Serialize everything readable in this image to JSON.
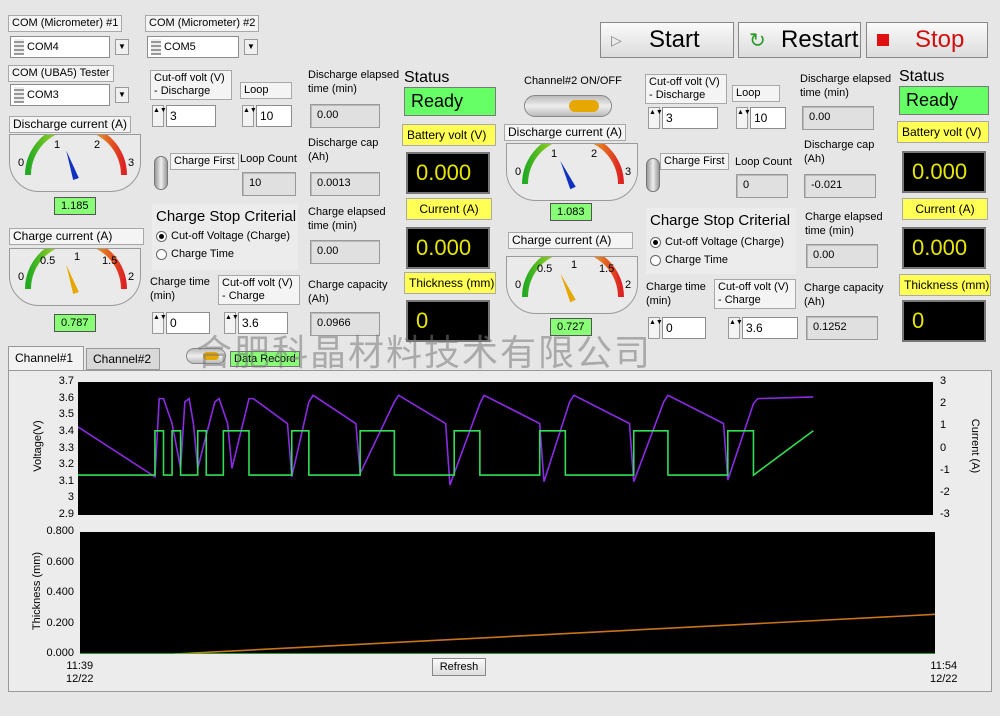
{
  "top": {
    "start": "Start",
    "restart": "Restart",
    "stop": "Stop"
  },
  "com": {
    "mic1_label": "COM (Micrometer) #1",
    "mic1_value": "COM4",
    "mic2_label": "COM (Micrometer) #2",
    "mic2_value": "COM5",
    "uba_label": "COM (UBA5) Tester",
    "uba_value": "COM3"
  },
  "ch1": {
    "discharge_current_label": "Discharge current (A)",
    "discharge_current_value": "1.185",
    "discharge_needle": 1.185,
    "charge_current_label": "Charge current (A)",
    "charge_current_value": "0.787",
    "charge_needle": 0.787,
    "cutoff_discharge_label": "Cut-off volt (V) - Discharge",
    "cutoff_discharge": "3",
    "loop_label": "Loop",
    "loop": "10",
    "discharge_elapsed_label": "Discharge elapsed time (min)",
    "discharge_elapsed": "0.00",
    "charge_first_label": "Charge First",
    "loop_count_label": "Loop Count",
    "loop_count": "10",
    "discharge_cap_label": "Discharge cap (Ah)",
    "discharge_cap": "0.0013",
    "stop_criteria_label": "Charge Stop Criterial",
    "opt_voltage": "Cut-off Voltage (Charge)",
    "opt_time": "Charge Time",
    "charge_elapsed_label": "Charge elapsed time (min)",
    "charge_elapsed": "0.00",
    "charge_time_label": "Charge time (min)",
    "charge_time": "0",
    "cutoff_charge_label": "Cut-off volt (V) - Charge",
    "cutoff_charge": "3.6",
    "charge_capacity_label": "Charge capacity (Ah)",
    "charge_capacity": "0.0966",
    "status_label": "Status",
    "status": "Ready",
    "battery_volt_label": "Battery volt (V)",
    "battery_volt": "0.000",
    "current_label": "Current (A)",
    "current": "0.000",
    "thickness_label": "Thickness (mm)",
    "thickness": "0"
  },
  "ch2": {
    "onoff_label": "Channel#2 ON/OFF",
    "discharge_current_label": "Discharge current (A)",
    "discharge_current_value": "1.083",
    "discharge_needle": 1.083,
    "charge_current_label": "Charge current (A)",
    "charge_current_value": "0.727",
    "charge_needle": 0.727,
    "cutoff_discharge_label": "Cut-off volt (V) - Discharge",
    "cutoff_discharge": "3",
    "loop_label": "Loop",
    "loop": "10",
    "discharge_elapsed_label": "Discharge elapsed time (min)",
    "discharge_elapsed": "0.00",
    "charge_first_label": "Charge First",
    "loop_count_label": "Loop Count",
    "loop_count": "0",
    "discharge_cap_label": "Discharge cap (Ah)",
    "discharge_cap": "-0.021",
    "stop_criteria_label": "Charge Stop Criterial",
    "opt_voltage": "Cut-off Voltage (Charge)",
    "opt_time": "Charge Time",
    "charge_elapsed_label": "Charge elapsed time (min)",
    "charge_elapsed": "0.00",
    "charge_time_label": "Charge time (min)",
    "charge_time": "0",
    "cutoff_charge_label": "Cut-off volt (V) - Charge",
    "cutoff_charge": "3.6",
    "charge_capacity_label": "Charge capacity (Ah)",
    "charge_capacity": "0.1252",
    "status_label": "Status",
    "status": "Ready",
    "battery_volt_label": "Battery volt (V)",
    "battery_volt": "0.000",
    "current_label": "Current (A)",
    "current": "0.000",
    "thickness_label": "Thickness (mm)",
    "thickness": "0"
  },
  "gauge_ticks": {
    "discharge": [
      "0",
      "1",
      "2",
      "3"
    ],
    "charge": [
      "0",
      "0.5",
      "1",
      "1.5",
      "2"
    ]
  },
  "tabs": [
    "Channel#1",
    "Channel#2"
  ],
  "data_record_label": "Data Record",
  "watermark": "合肥科晶材料技术有限公司",
  "refresh": "Refresh",
  "x_start": "11:39\n12/22",
  "x_end": "11:54\n12/22",
  "chart_data": [
    {
      "type": "line",
      "ylabel": "Voltage(V)",
      "y2label": "Current (A)",
      "ylim": [
        2.9,
        3.7
      ],
      "y2lim": [
        -3,
        3
      ],
      "yticks": [
        "3.7",
        "3.6",
        "3.5",
        "3.4",
        "3.3",
        "3.2",
        "3.1",
        "3",
        "2.9"
      ],
      "y2ticks": [
        "3",
        "2",
        "1",
        "0",
        "-1",
        "-2",
        "-3"
      ],
      "series": [
        {
          "color": "#8a2be2",
          "x": [
            0,
            0.09,
            0.095,
            0.1,
            0.11,
            0.12,
            0.125,
            0.13,
            0.135,
            0.14,
            0.16,
            0.165,
            0.175,
            0.18,
            0.2,
            0.205,
            0.245,
            0.25,
            0.27,
            0.275,
            0.325,
            0.33,
            0.37,
            0.375,
            0.43,
            0.435,
            0.47,
            0.475,
            0.54,
            0.545,
            0.575,
            0.58,
            0.645,
            0.65,
            0.685,
            0.69,
            0.755,
            0.76,
            0.79,
            0.795,
            0.86
          ],
          "y": [
            3.43,
            3.13,
            3.6,
            3.6,
            3.45,
            3.18,
            3.58,
            3.6,
            3.45,
            3.18,
            3.58,
            3.6,
            3.45,
            3.18,
            3.6,
            3.6,
            3.45,
            3.13,
            3.58,
            3.62,
            3.45,
            3.15,
            3.58,
            3.62,
            3.45,
            3.08,
            3.57,
            3.62,
            3.45,
            3.1,
            3.58,
            3.62,
            3.45,
            3.1,
            3.58,
            3.62,
            3.45,
            3.11,
            3.57,
            3.6,
            3.61
          ]
        },
        {
          "color": "#33dd55",
          "x": [
            0,
            0.09,
            0.09,
            0.1,
            0.1,
            0.11,
            0.11,
            0.12,
            0.12,
            0.14,
            0.14,
            0.15,
            0.15,
            0.17,
            0.17,
            0.2,
            0.2,
            0.25,
            0.25,
            0.27,
            0.27,
            0.33,
            0.33,
            0.37,
            0.37,
            0.44,
            0.44,
            0.47,
            0.47,
            0.54,
            0.54,
            0.57,
            0.57,
            0.65,
            0.65,
            0.69,
            0.69,
            0.76,
            0.76,
            0.79,
            0.79,
            0.86
          ],
          "y": [
            -1.2,
            -1.2,
            0.8,
            0.8,
            -1.2,
            -1.2,
            0.8,
            0.8,
            -1.2,
            -1.2,
            0.8,
            0.8,
            -1.2,
            -1.2,
            0.8,
            0.8,
            -1.2,
            -1.2,
            0.8,
            0.8,
            -1.2,
            -1.2,
            0.8,
            0.8,
            -1.2,
            -1.2,
            0.8,
            0.8,
            -1.2,
            -1.2,
            0.8,
            0.8,
            -1.2,
            -1.2,
            0.8,
            0.8,
            -1.2,
            -1.2,
            0.8,
            0.8,
            -1.2,
            0.8
          ]
        }
      ]
    },
    {
      "type": "line",
      "ylabel": "Thickness (mm)",
      "ylim": [
        0,
        0.8
      ],
      "yticks": [
        "0.800",
        "0.600",
        "0.400",
        "0.200",
        "0.000"
      ],
      "series": [
        {
          "color": "#c8741c",
          "x": [
            0.11,
            1
          ],
          "y": [
            0,
            0.26
          ]
        },
        {
          "color": "#33cc33",
          "x": [
            0,
            1
          ],
          "y": [
            0,
            0
          ]
        }
      ]
    }
  ]
}
